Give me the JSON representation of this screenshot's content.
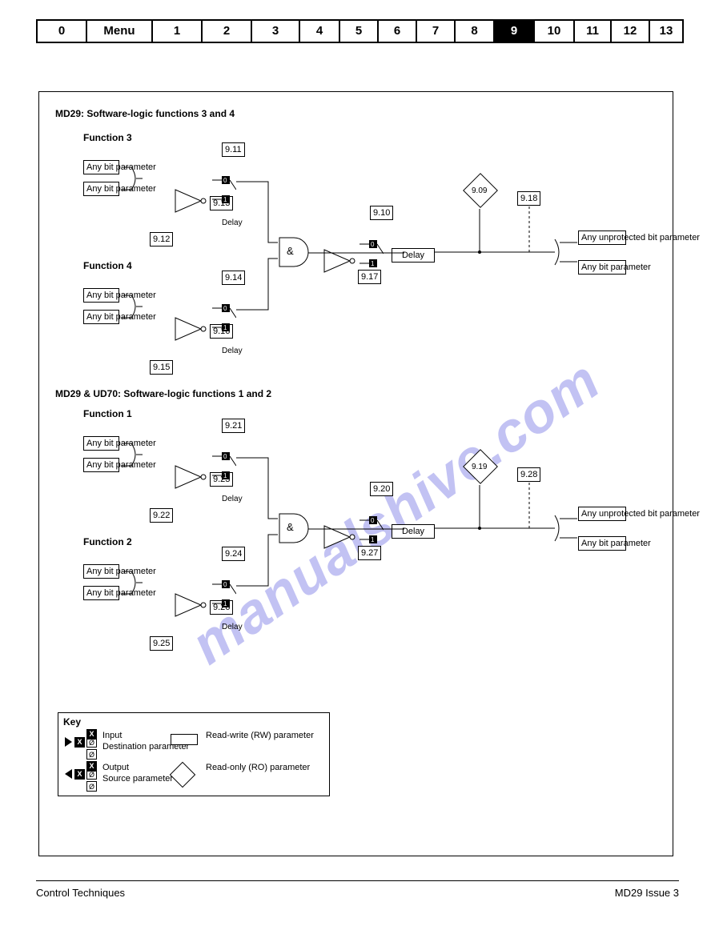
{
  "tabs": [
    "0",
    "Menu",
    "1",
    "2",
    "3",
    "4",
    "5",
    "6",
    "7",
    "8",
    "9",
    "10",
    "11",
    "12",
    "13"
  ],
  "active_index": 10,
  "footer": {
    "left": "Control Techniques",
    "right": "MD29 Issue 3"
  },
  "watermark": "manualshive.com",
  "panel": {
    "heading": {
      "a": "MD29: Software-logic functions 3 and 4",
      "b": "MD29 & UD70: Software-logic functions 1 and 2"
    },
    "legend": {
      "title": "Key",
      "row1": {
        "a": "Input",
        "b": "Destination parameter",
        "c": "Read-write (RW) parameter"
      },
      "row2": {
        "a": "Output",
        "b": "Source parameter",
        "c": "Read-only (RO) parameter"
      }
    },
    "blocks": {
      "f3": {
        "title": "Function 3",
        "src1": {
          "any": "Any bit parameter",
          "any2": "Any bit parameter",
          "src": "9.12",
          "inv": "9.13",
          "delay": "9.11",
          "delayLbl": "Delay"
        }
      },
      "f4": {
        "title": "Function 4",
        "src1": {
          "any": "Any bit parameter",
          "any2": "Any bit parameter",
          "src": "9.15",
          "inv": "9.16",
          "delay": "9.14",
          "delayLbl": "Delay"
        }
      },
      "output34": {
        "inv": "9.17",
        "delay": "9.10",
        "dest": "9.18",
        "ro": "9.09",
        "any": "Any bit parameter",
        "anyUn": "Any unprotected bit parameter",
        "delayBox": "Delay"
      },
      "f1": {
        "title": "Function 1",
        "src1": {
          "any": "Any bit parameter",
          "any2": "Any bit parameter",
          "src": "9.22",
          "inv": "9.23",
          "delay": "9.21",
          "delayLbl": "Delay"
        }
      },
      "f2": {
        "title": "Function 2",
        "src1": {
          "any": "Any bit parameter",
          "any2": "Any bit parameter",
          "src": "9.25",
          "inv": "9.26",
          "delay": "9.24",
          "delayLbl": "Delay"
        }
      },
      "output12": {
        "inv": "9.27",
        "delay": "9.20",
        "dest": "9.28",
        "ro": "9.19",
        "any": "Any bit parameter",
        "anyUn": "Any unprotected bit parameter",
        "delayBox": "Delay"
      }
    }
  }
}
